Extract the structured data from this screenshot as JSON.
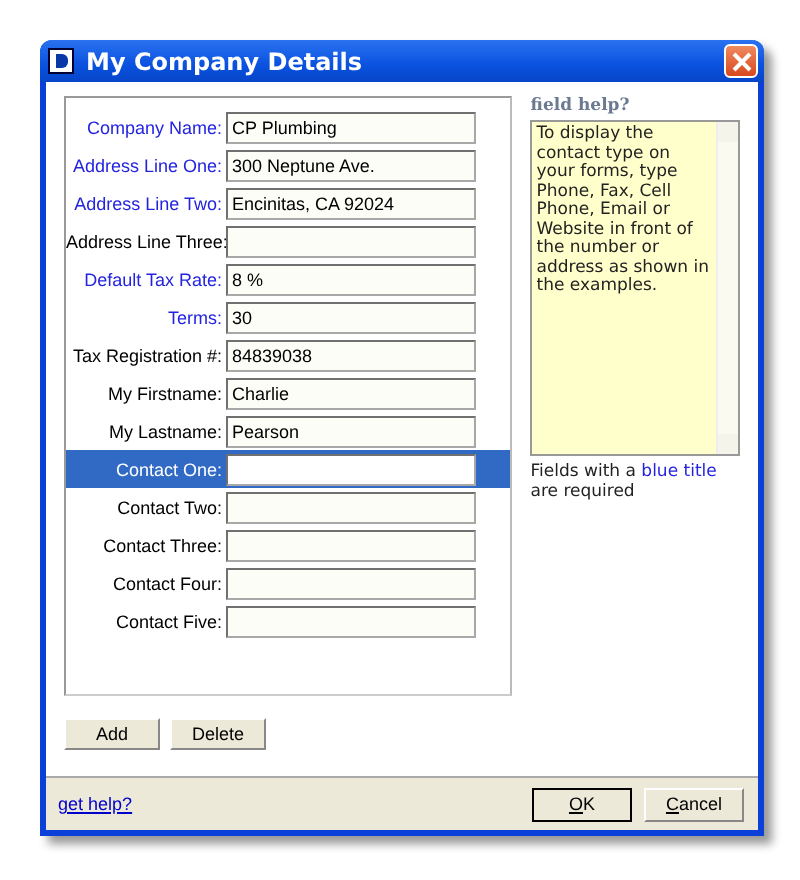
{
  "window": {
    "title": "My Company Details"
  },
  "fields": [
    {
      "label": "Company Name:",
      "value": "CP Plumbing",
      "required": true,
      "selected": false
    },
    {
      "label": "Address Line One:",
      "value": "300 Neptune Ave.",
      "required": true,
      "selected": false
    },
    {
      "label": "Address Line Two:",
      "value": "Encinitas, CA 92024",
      "required": true,
      "selected": false
    },
    {
      "label": "Address Line Three:",
      "required": false,
      "selected": false
    },
    {
      "label": "Default Tax Rate:",
      "value": "8 %",
      "required": true,
      "selected": false
    },
    {
      "label": "Terms:",
      "value": "30",
      "required": true,
      "selected": false
    },
    {
      "label": "Tax Registration #:",
      "value": "84839038",
      "required": false,
      "selected": false
    },
    {
      "label": "My Firstname:",
      "value": "Charlie",
      "required": false,
      "selected": false
    },
    {
      "label": "My Lastname:",
      "value": "Pearson",
      "required": false,
      "selected": false
    },
    {
      "label": "Contact One:",
      "required": false,
      "selected": true
    },
    {
      "label": "Contact Two:",
      "required": false,
      "selected": false
    },
    {
      "label": "Contact Three:",
      "required": false,
      "selected": false
    },
    {
      "label": "Contact Four:",
      "required": false,
      "selected": false
    },
    {
      "label": "Contact Five:",
      "required": false,
      "selected": false
    }
  ],
  "list_buttons": [
    "Add",
    "Delete"
  ],
  "help": {
    "title": "field help?",
    "text": "To display the contact type on your forms, type Phone, Fax, Cell Phone, Email or Website in front of the number or address as shown in the examples.",
    "note": [
      {
        "text": "Fields with a ",
        "kind": "plain"
      },
      {
        "text": "blue title",
        "kind": "blue"
      },
      {
        "text": " are required",
        "kind": "plain"
      }
    ]
  },
  "footer": {
    "link": "get help?",
    "buttons": [
      {
        "label": "OK",
        "default": true
      },
      {
        "label": "Cancel",
        "default": false
      }
    ]
  }
}
